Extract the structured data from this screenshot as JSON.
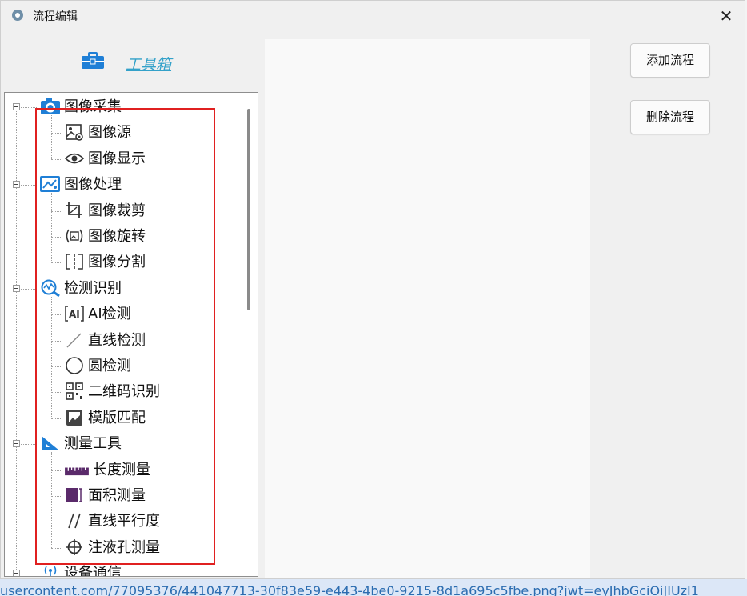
{
  "window": {
    "title": "流程编辑",
    "close_symbol": "✕"
  },
  "toolbox": {
    "label": "工具箱"
  },
  "tree": [
    {
      "group": "图像采集",
      "icon": "camera-icon",
      "items": [
        {
          "label": "图像源",
          "icon": "image-source-icon"
        },
        {
          "label": "图像显示",
          "icon": "eye-icon"
        }
      ]
    },
    {
      "group": "图像处理",
      "icon": "image-process-icon",
      "items": [
        {
          "label": "图像裁剪",
          "icon": "crop-icon"
        },
        {
          "label": "图像旋转",
          "icon": "rotate-icon"
        },
        {
          "label": "图像分割",
          "icon": "split-icon"
        }
      ]
    },
    {
      "group": "检测识别",
      "icon": "detect-icon",
      "items": [
        {
          "label": "AI检测",
          "icon": "ai-icon"
        },
        {
          "label": "直线检测",
          "icon": "line-icon"
        },
        {
          "label": "圆检测",
          "icon": "circle-icon"
        },
        {
          "label": "二维码识别",
          "icon": "qrcode-icon"
        },
        {
          "label": "模版匹配",
          "icon": "template-icon"
        }
      ]
    },
    {
      "group": "测量工具",
      "icon": "measure-tool-icon",
      "items": [
        {
          "label": "长度测量",
          "icon": "ruler-icon"
        },
        {
          "label": "面积测量",
          "icon": "area-icon"
        },
        {
          "label": "直线平行度",
          "icon": "parallel-icon"
        },
        {
          "label": "注液孔测量",
          "icon": "crosshair-icon"
        }
      ]
    },
    {
      "group": "设备通信",
      "icon": "signal-icon",
      "items": []
    }
  ],
  "buttons": {
    "add_flow": "添加流程",
    "delete_flow": "删除流程"
  },
  "status_url": "usercontent.com/77095376/441047713-30f83e59-e443-4be0-9215-8d1a695c5fbe.png?jwt=eyJhbGciOiJIUzI1",
  "colors": {
    "accent_link": "#33a1c9",
    "highlight_box": "#e02020",
    "icon_blue": "#1f7fd6",
    "icon_purple": "#5a2a6a"
  }
}
